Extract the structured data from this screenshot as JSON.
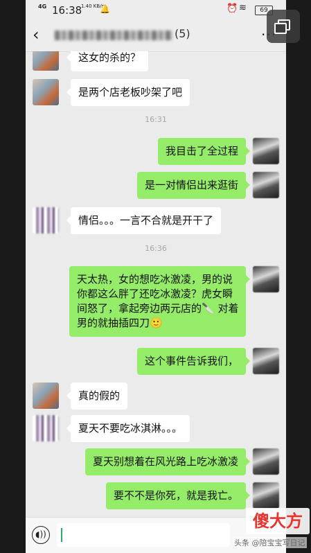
{
  "status_bar": {
    "network": "4G",
    "time": "16:38",
    "speed": "1.40 KB/s",
    "battery": "69"
  },
  "header": {
    "count": "(5)"
  },
  "messages": [
    {
      "side": "left",
      "avatar": "a",
      "text": "这女的杀的？"
    },
    {
      "side": "left",
      "avatar": "a",
      "text": "是两个店老板吵架了吧"
    },
    {
      "type": "time",
      "text": "16:31"
    },
    {
      "side": "right",
      "avatar": "c",
      "text": "我目击了全过程"
    },
    {
      "side": "right",
      "avatar": "c",
      "text": "是一对情侣出来逛街"
    },
    {
      "side": "left",
      "avatar": "b",
      "text": "情侣。。。一言不合就是开干了"
    },
    {
      "type": "time",
      "text": "16:36"
    },
    {
      "side": "right",
      "avatar": "c",
      "lines": [
        "天太热，女的想吃冰激凌，男的说",
        "你都这么胖了还吃冰激凌？虎女瞬",
        "间怒了，拿起旁边两元店的🔪 对着",
        "男的就抽插四刀🙂"
      ]
    },
    {
      "side": "right",
      "avatar": "c",
      "text": "这个事件告诉我们，"
    },
    {
      "side": "left",
      "avatar": "a",
      "text": "真的假的"
    },
    {
      "side": "left",
      "avatar": "b",
      "text": "夏天不要吃冰淇淋。。。"
    },
    {
      "side": "right",
      "avatar": "c",
      "text": "夏天别想着在风光路上吃冰激凌"
    },
    {
      "side": "right",
      "avatar": "c",
      "text": "要不不是你死，就是我亡。"
    }
  ],
  "watermark": {
    "brand": "傻大方",
    "source": "头条 @陪宝宝写日记"
  },
  "icons": {
    "back": "chevron-left-icon",
    "more": "more-dots-icon",
    "voice": "voice-icon",
    "floating": "floating-window-icon"
  },
  "colors": {
    "chat_bg": "#ebebeb",
    "sent_bubble": "#95ec69",
    "received_bubble": "#ffffff",
    "watermark_red": "#e8342e"
  }
}
